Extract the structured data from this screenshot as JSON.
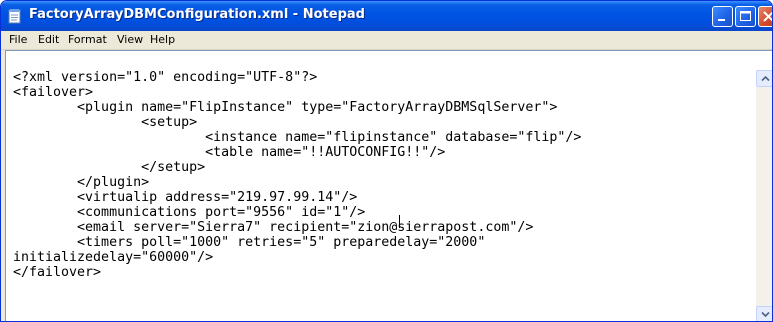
{
  "window": {
    "title": "FactoryArrayDBMConfiguration.xml - Notepad",
    "app_icon": "notepad-icon",
    "controls": {
      "minimize": "minimize-icon",
      "maximize": "maximize-icon",
      "close": "close-icon"
    }
  },
  "menu": {
    "items": [
      {
        "label": "File"
      },
      {
        "label": "Edit"
      },
      {
        "label": "Format"
      },
      {
        "label": "View"
      },
      {
        "label": "Help"
      }
    ]
  },
  "editor": {
    "lines": [
      "<?xml version=\"1.0\" encoding=\"UTF-8\"?>",
      "<failover>",
      "        <plugin name=\"FlipInstance\" type=\"FactoryArrayDBMSqlServer\">",
      "                <setup>",
      "                        <instance name=\"flipinstance\" database=\"flip\"/>",
      "                        <table name=\"!!AUTOCONFIG!!\"/>",
      "                </setup>",
      "        </plugin>",
      "        <virtualip address=\"219.97.99.14\"/>",
      "        <communications port=\"9556\" id=\"1\"/>",
      "        <email server=\"Sierra7\" recipient=\"zion@sierrapost.com\"/>",
      "        <timers poll=\"1000\" retries=\"5\" preparedelay=\"2000\"",
      "initializedelay=\"60000\"/>",
      "</failover>"
    ]
  },
  "scrollbar": {
    "up_icon": "scroll-up-arrow-icon",
    "down_icon": "scroll-down-arrow-icon"
  },
  "colors": {
    "titlebar": "#0054e3",
    "close_button": "#d2482a",
    "window_frame": "#ece9d8"
  }
}
